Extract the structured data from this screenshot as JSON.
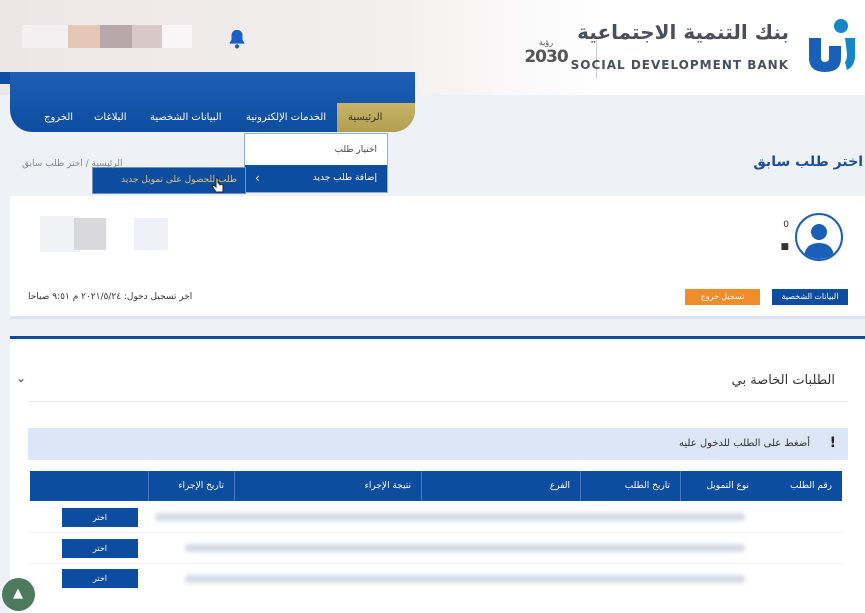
{
  "header": {
    "bank_name_ar": "بنك التنمية الاجتماعية",
    "bank_name_en": "SOCIAL DEVELOPMENT BANK",
    "vision_label": "رؤية",
    "vision_year": "2030",
    "icons": {
      "notification": "bell-icon"
    }
  },
  "nav": {
    "items": [
      "الرئيسية",
      "الخدمات الإلكترونية",
      "البيانات الشخصية",
      "البلاغات",
      "الخروج"
    ]
  },
  "dropdown": {
    "item1": "اختيار طلب",
    "item2": "إضافة طلب جديد",
    "submenu": "طلب للحصول على تمويل جديد"
  },
  "breadcrumb": "الرئيسية / اختر طلب سابق",
  "page_title": "اختر طلب سابق",
  "profile": {
    "last_login": "اخر تسجيل دخول: ٢٠٢١/٥/٢٤ م ٩:٥١ صباحا",
    "logout_label": "تسجيل خروج",
    "personal_label": "البيانات الشخصية",
    "mini1": "0",
    "mini2": "■"
  },
  "requests": {
    "title": "الطلبات الخاصة بي",
    "alert_text": "أضغط على الطلب للدخول عليه",
    "alert_icon": "!",
    "columns": [
      "رقم الطلب",
      "نوع التمويل",
      "تاريخ الطلب",
      "الفرع",
      "نتيجة الإجراء",
      "تاريخ الإجراء"
    ],
    "row_action": "اختر"
  },
  "colors": {
    "primary": "#0d4da0",
    "accent_gold": "#c7b46a",
    "logout_orange": "#ee8d2a"
  }
}
